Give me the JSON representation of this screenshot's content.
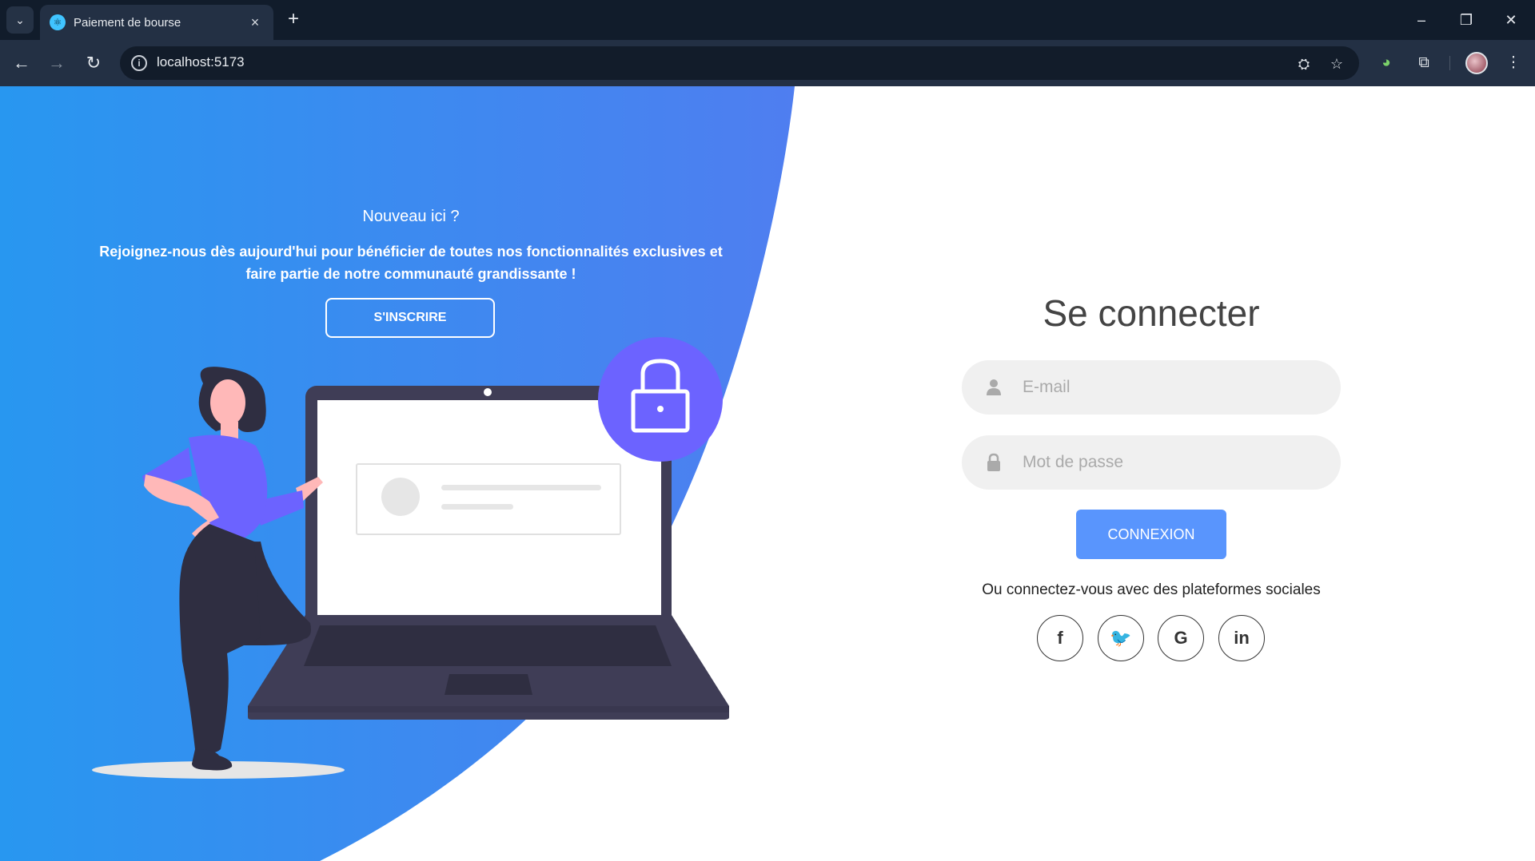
{
  "browser": {
    "tab_title": "Paiement de bourse",
    "url": "localhost:5173",
    "icons": [
      "tab-list-icon",
      "close-icon",
      "plus-icon",
      "minimize-icon",
      "restore-icon",
      "window-close-icon",
      "back-arrow-icon",
      "forward-arrow-icon",
      "reload-icon",
      "info-icon",
      "translate-icon",
      "star-icon",
      "extension-icon",
      "puzzle-icon",
      "more-vertical-icon"
    ]
  },
  "promo": {
    "title": "Nouveau ici ?",
    "text": "Rejoignez-nous dès aujourd'hui pour bénéficier de toutes nos fonctionnalités exclusives et faire partie de notre communauté grandissante !",
    "signup_label": "S'INSCRIRE"
  },
  "login": {
    "title": "Se connecter",
    "email_placeholder": "E-mail",
    "password_placeholder": "Mot de passe",
    "submit_label": "CONNEXION",
    "social_text": "Ou connectez-vous avec des plateformes sociales",
    "socials": [
      {
        "icon": "facebook-icon",
        "glyph": "f"
      },
      {
        "icon": "twitter-icon",
        "glyph": "🐦"
      },
      {
        "icon": "google-icon",
        "glyph": "G"
      },
      {
        "icon": "linkedin-icon",
        "glyph": "in"
      }
    ]
  },
  "colors": {
    "primary": "#5995fd",
    "gradient_start": "#2897f0",
    "gradient_end": "#4f7ef0",
    "illustration_purple": "#6c63ff",
    "laptop_dark": "#3f3d56"
  }
}
